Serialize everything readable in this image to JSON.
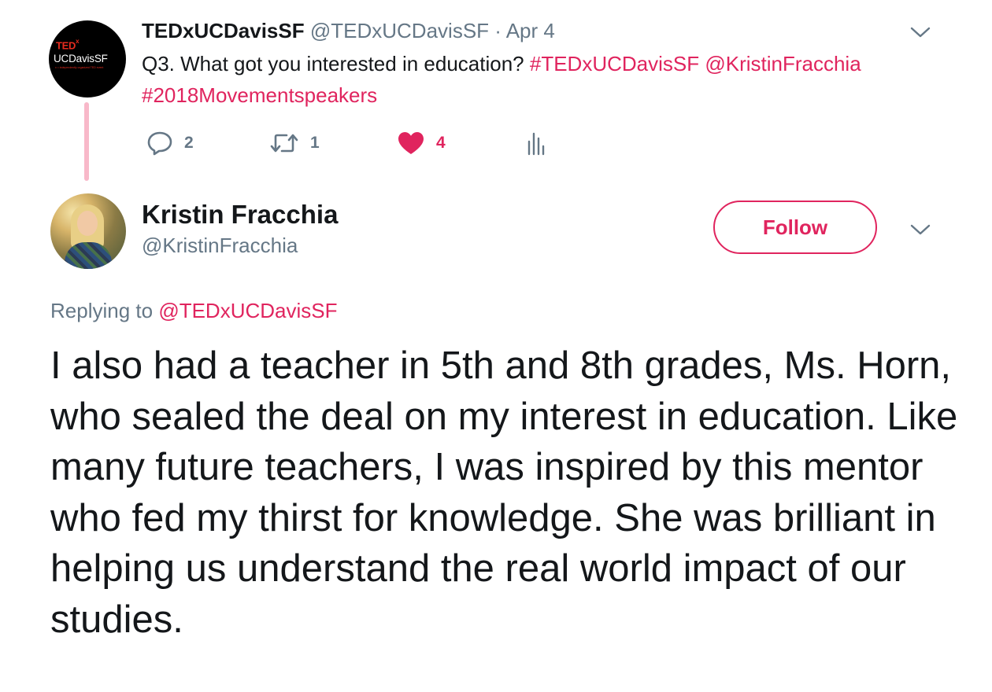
{
  "parent_tweet": {
    "avatar": {
      "brand_top": "TED",
      "brand_sup": "x",
      "brand_name": "UCDavisSF",
      "brand_small": "x = independently organized TED event"
    },
    "display_name": "TEDxUCDavisSF",
    "handle": "@TEDxUCDavisSF",
    "separator": " · ",
    "date": "Apr 4",
    "text_plain": "Q3. What got you interested in education? ",
    "hashtag_1": "#TEDxUCDavisSF",
    "mention": "@KristinFracchia",
    "hashtag_2": "#2018Movementspeakers",
    "actions": {
      "reply_count": "2",
      "retweet_count": "1",
      "like_count": "4",
      "reply_icon": "reply-icon",
      "retweet_icon": "retweet-icon",
      "like_icon": "heart-icon",
      "analytics_icon": "analytics-icon"
    }
  },
  "reply_tweet": {
    "display_name": "Kristin Fracchia",
    "handle": "@KristinFracchia",
    "follow_label": "Follow",
    "replying_prefix": "Replying to ",
    "replying_to": "@TEDxUCDavisSF",
    "body": "I also had a teacher in 5th and 8th grades, Ms. Horn, who sealed the deal on my interest in education. Like many future teachers, I was inspired by this mentor who fed my thirst for knowledge. She was brilliant in helping us understand the real world impact of our studies."
  },
  "colors": {
    "accent": "#e0245e",
    "muted": "#657786",
    "text": "#14171a",
    "thread_line": "#f8b8c9"
  }
}
